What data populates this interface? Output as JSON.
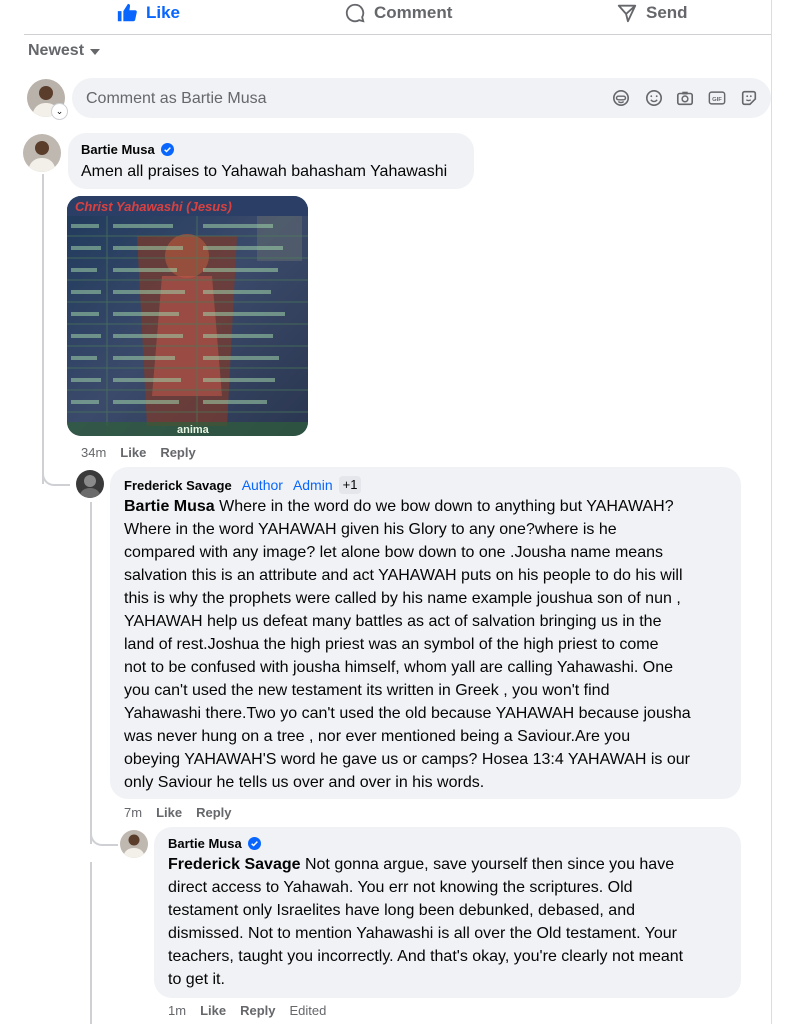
{
  "actions": {
    "like": "Like",
    "comment": "Comment",
    "send": "Send"
  },
  "sort_label": "Newest",
  "composer": {
    "placeholder": "Comment as Bartie Musa"
  },
  "comments": [
    {
      "author": "Bartie Musa",
      "verified": true,
      "text": "Amen all praises to Yahawah bahasham Yahawashi",
      "image_caption_top": "Christ Yahawashi (Jesus)",
      "image_caption_bottom": "anima",
      "time": "34m",
      "like": "Like",
      "reply": "Reply"
    },
    {
      "author": "Frederick Savage",
      "badges": [
        "Author",
        "Admin"
      ],
      "plus": "+1",
      "mention": "Bartie Musa",
      "lines": [
        " Where in the word do we bow down to anything but YAHAWAH?",
        "Where in the word YAHAWAH given his Glory to any one?where is he",
        "compared with any image? let alone bow down to one .Jousha name means",
        "salvation this is an attribute and act YAHAWAH puts on his people to do his will",
        "this is why the prophets were called by his name example joushua son of nun ,",
        "YAHAWAH help us defeat many battles as act of salvation bringing us in the",
        "land of rest.Joshua the high priest was an symbol of the high priest to come",
        "not to be confused with jousha himself, whom yall are calling Yahawashi. One",
        "you can't used the new testament its written in Greek , you won't find",
        "Yahawashi there.Two yo can't used the old because YAHAWAH because jousha",
        "was never hung on a tree , nor ever mentioned being a Saviour.Are you",
        "obeying YAHAWAH'S word he gave us or camps? Hosea 13:4 YAHAWAH is our",
        "only Saviour he tells us over and over in his words."
      ],
      "time": "7m",
      "like": "Like",
      "reply": "Reply"
    },
    {
      "author": "Bartie Musa",
      "verified": true,
      "mention": "Frederick Savage",
      "lines": [
        " Not gonna argue, save yourself then since you have",
        "direct access to Yahawah. You err not knowing the scriptures. Old",
        "testament only Israelites have long been debunked, debased, and",
        "dismissed. Not to mention Yahawashi is all over the Old testament. Your",
        "teachers, taught you incorrectly. And that's okay, you're clearly not meant",
        "to get it."
      ],
      "time": "1m",
      "like": "Like",
      "reply": "Reply",
      "edited": "Edited"
    }
  ],
  "colors": {
    "link": "#0866ff",
    "bubble": "#f0f2f5",
    "muted": "#65676b"
  }
}
